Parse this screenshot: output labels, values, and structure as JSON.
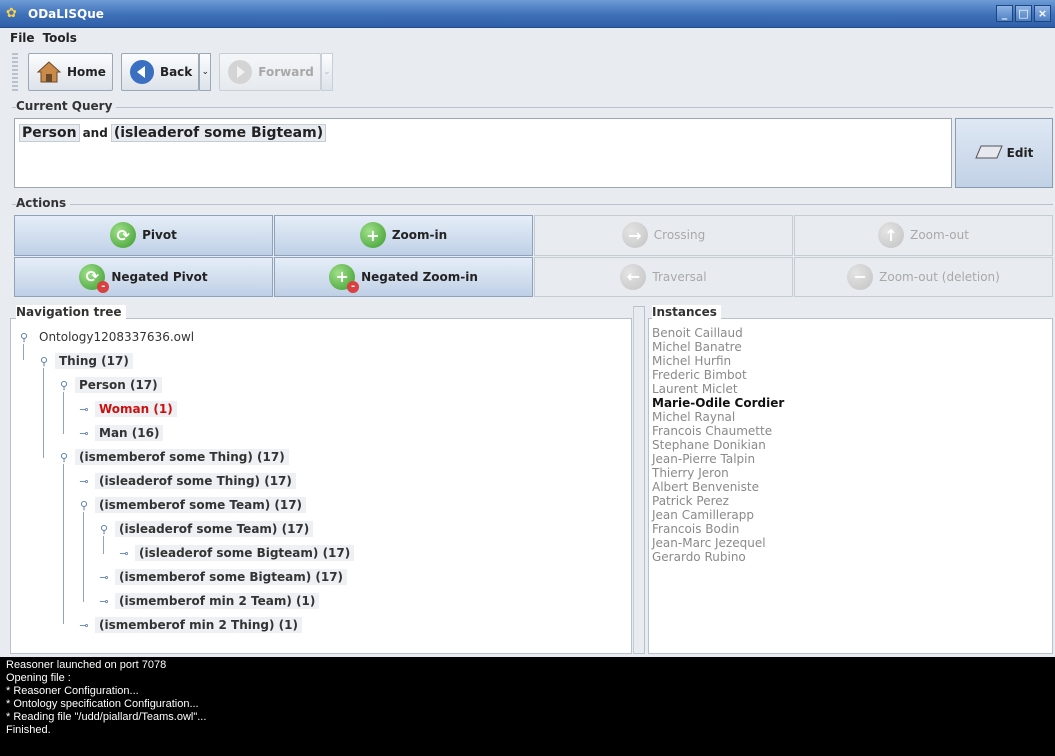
{
  "window": {
    "title": "ODaLISQue",
    "controls": [
      "_",
      "□",
      "×"
    ]
  },
  "menu": {
    "items": [
      "File",
      "Tools"
    ]
  },
  "toolbar": {
    "home_label": "Home",
    "back_label": "Back",
    "forward_label": "Forward"
  },
  "query": {
    "section_label": "Current Query",
    "token1": "Person",
    "connector": "and",
    "token2": "(isleaderof some Bigteam)",
    "edit_label": "Edit"
  },
  "actions": {
    "section_label": "Actions",
    "pivot": "Pivot",
    "zoom_in": "Zoom-in",
    "crossing": "Crossing",
    "zoom_out": "Zoom-out",
    "negated_pivot": "Negated Pivot",
    "negated_zoom_in": "Negated Zoom-in",
    "traversal": "Traversal",
    "zoom_out_deletion": "Zoom-out (deletion)"
  },
  "navigation": {
    "section_label": "Navigation tree",
    "nodes": [
      "Ontology1208337636.owl",
      "Thing (17)",
      "Person (17)",
      "Woman (1)",
      "Man (16)",
      "(ismemberof some Thing) (17)",
      "(isleaderof some Thing) (17)",
      "(ismemberof some Team) (17)",
      "(isleaderof some Team) (17)",
      "(isleaderof some Bigteam) (17)",
      "(ismemberof some Bigteam) (17)",
      "(ismemberof min 2 Team) (1)",
      "(ismemberof min 2 Thing) (1)"
    ]
  },
  "instances": {
    "section_label": "Instances",
    "items": [
      "Benoit Caillaud",
      "Michel Banatre",
      "Michel Hurfin",
      "Frederic Bimbot",
      "Laurent Miclet",
      "Marie-Odile Cordier",
      "Michel Raynal",
      "Francois Chaumette",
      "Stephane Donikian",
      "Jean-Pierre Talpin",
      "Thierry Jeron",
      "Albert Benveniste",
      "Patrick Perez",
      "Jean Camillerapp",
      "Francois Bodin",
      "Jean-Marc Jezequel",
      "Gerardo Rubino"
    ],
    "selected": "Marie-Odile Cordier"
  },
  "console": {
    "lines": [
      "Reasoner launched on port 7078",
      "Opening file :",
      "* Reasoner Configuration...",
      "* Ontology specification Configuration...",
      "* Reading file \"/udd/piallard/Teams.owl\"...",
      "Finished."
    ]
  },
  "colors": {
    "title_bar": "#3e70b8",
    "highlight_red": "#cc1010",
    "console_bg": "#000000"
  }
}
